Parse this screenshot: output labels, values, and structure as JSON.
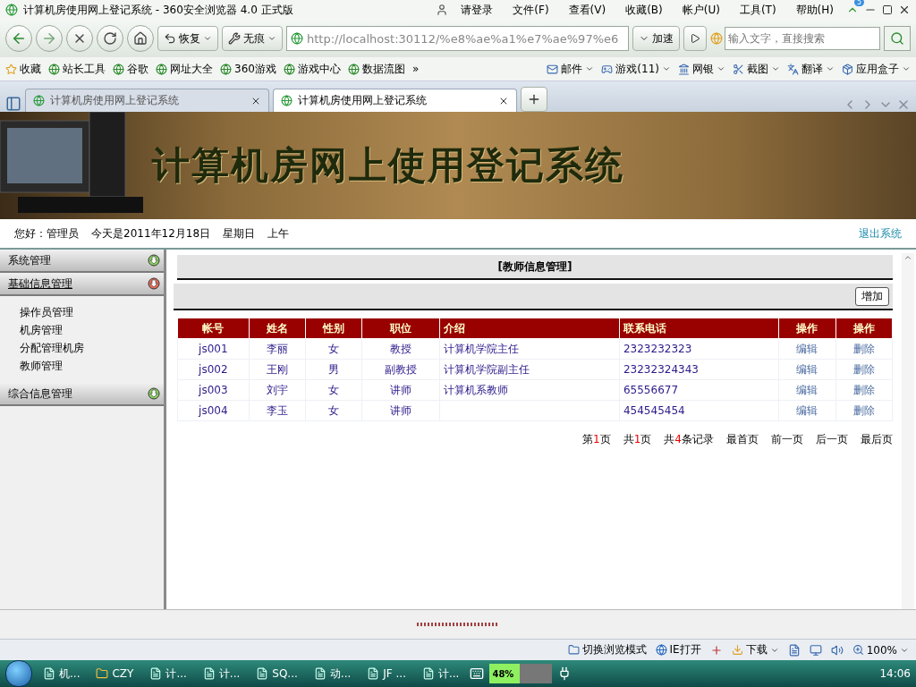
{
  "window": {
    "title": "计算机房使用网上登记系统 - 360安全浏览器 4.0 正式版",
    "notification_count": "5"
  },
  "title_bar": {
    "login": "请登录",
    "menus": [
      "文件(F)",
      "查看(V)",
      "收藏(B)",
      "帐户(U)",
      "工具(T)",
      "帮助(H)"
    ]
  },
  "toolbar": {
    "restore": "恢复",
    "private": "无痕",
    "address": "http://localhost:30112/%e8%ae%a1%e7%ae%97%e6",
    "speed": "加速",
    "search_placeholder": "输入文字，直接搜索"
  },
  "bookmarks": [
    {
      "label": "收藏"
    },
    {
      "label": "站长工具"
    },
    {
      "label": "谷歌"
    },
    {
      "label": "网址大全"
    },
    {
      "label": "360游戏"
    },
    {
      "label": "游戏中心"
    },
    {
      "label": "数据流图"
    }
  ],
  "bookmarks_more": "»",
  "bookmarks_right": [
    {
      "label": "邮件"
    },
    {
      "label": "游戏(11)"
    },
    {
      "label": "网银"
    },
    {
      "label": "截图"
    },
    {
      "label": "翻译"
    },
    {
      "label": "应用盒子"
    }
  ],
  "tabs": [
    {
      "label": "计算机房使用网上登记系统",
      "selected": false
    },
    {
      "label": "计算机房使用网上登记系统",
      "selected": true
    }
  ],
  "page": {
    "banner_title": "计算机房网上使用登记系统",
    "greeting": "您好：管理员",
    "date": "今天是2011年12月18日",
    "weekday": "星期日",
    "period": "上午",
    "logout": "退出系统"
  },
  "sidebar": {
    "sections": [
      {
        "label": "系统管理",
        "expanded": false
      },
      {
        "label": "基础信息管理",
        "expanded": true,
        "children": [
          {
            "label": "操作员管理"
          },
          {
            "label": "机房管理"
          },
          {
            "label": "分配管理机房"
          },
          {
            "label": "教师管理"
          }
        ]
      },
      {
        "label": "综合信息管理",
        "expanded": false
      }
    ]
  },
  "main": {
    "heading": "[教师信息管理]",
    "add_button": "增加",
    "table": {
      "columns": [
        "帐号",
        "姓名",
        "性别",
        "职位",
        "介绍",
        "联系电话",
        "操作",
        "操作"
      ],
      "rows": [
        {
          "cells": [
            "js001",
            "李丽",
            "女",
            "教授",
            "计算机学院主任",
            "2323232323"
          ],
          "actions": [
            "编辑",
            "删除"
          ]
        },
        {
          "cells": [
            "js002",
            "王刚",
            "男",
            "副教授",
            "计算机学院副主任",
            "23232324343"
          ],
          "actions": [
            "编辑",
            "删除"
          ]
        },
        {
          "cells": [
            "js003",
            "刘宇",
            "女",
            "讲师",
            "计算机系教师",
            "65556677"
          ],
          "actions": [
            "编辑",
            "删除"
          ]
        },
        {
          "cells": [
            "js004",
            "李玉",
            "女",
            "讲师",
            "",
            "454545454"
          ],
          "actions": [
            "编辑",
            "删除"
          ]
        }
      ]
    },
    "pagination": {
      "info": [
        {
          "prefix": "第",
          "number": "1",
          "suffix": "页"
        },
        {
          "prefix": "共",
          "number": "1",
          "suffix": "页"
        },
        {
          "prefix": "共",
          "number": "4",
          "suffix": "条记录"
        }
      ],
      "links": [
        "最首页",
        "前一页",
        "后一页",
        "最后页"
      ]
    }
  },
  "status_bar": {
    "items": [
      "切换浏览模式",
      "IE打开"
    ],
    "download": "下载",
    "zoom": "100%"
  },
  "taskbar": {
    "items": [
      "机...",
      "CZY",
      "计...",
      "计...",
      "SQ...",
      "动...",
      "JF ...",
      "计..."
    ],
    "battery": {
      "level": 0.48,
      "reading": "48%"
    },
    "clock": "14:06"
  }
}
